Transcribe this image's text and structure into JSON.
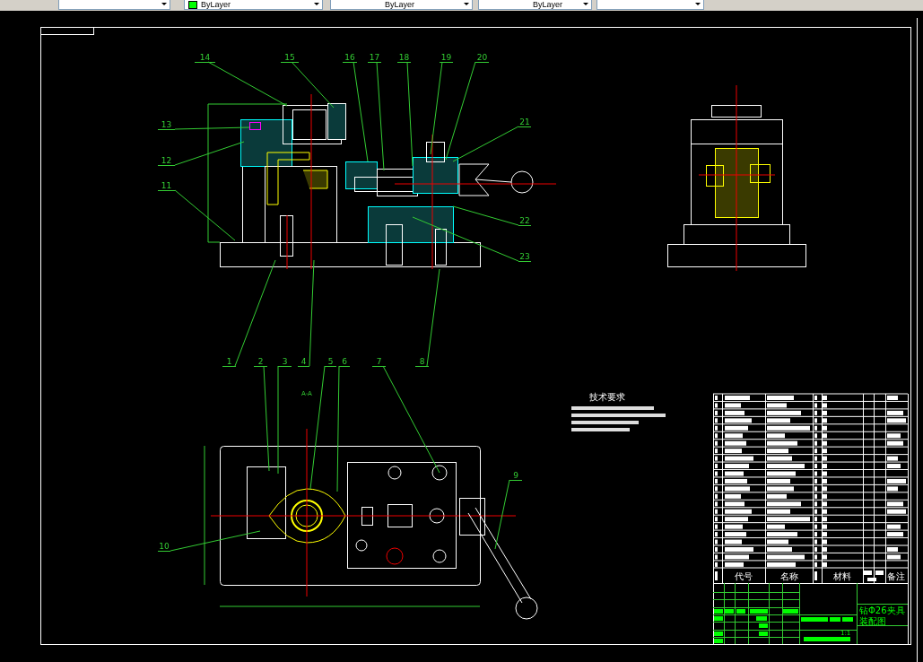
{
  "toolbar": {
    "combos": [
      {
        "kind": "blank"
      },
      {
        "kind": "layer",
        "text": "ByLayer"
      },
      {
        "kind": "plain",
        "text": "ByLayer"
      },
      {
        "kind": "plain",
        "text": "ByLayer"
      },
      {
        "kind": "blank"
      }
    ]
  },
  "drawing": {
    "balloons": [
      "14",
      "15",
      "16",
      "17",
      "18",
      "19",
      "20",
      "21",
      "22",
      "23",
      "13",
      "12",
      "11",
      "1",
      "2",
      "3",
      "4",
      "5",
      "6",
      "7",
      "8",
      "9",
      "10"
    ],
    "section_label": "A-A",
    "tech_requirements": {
      "title": "技术要求"
    },
    "parts_list": {
      "headers": [
        "代号",
        "名称",
        "材料",
        "备注"
      ]
    },
    "title_block": {
      "name": "钻Φ26夹具",
      "drawing_type": "装配图",
      "scale": "1:1"
    }
  }
}
